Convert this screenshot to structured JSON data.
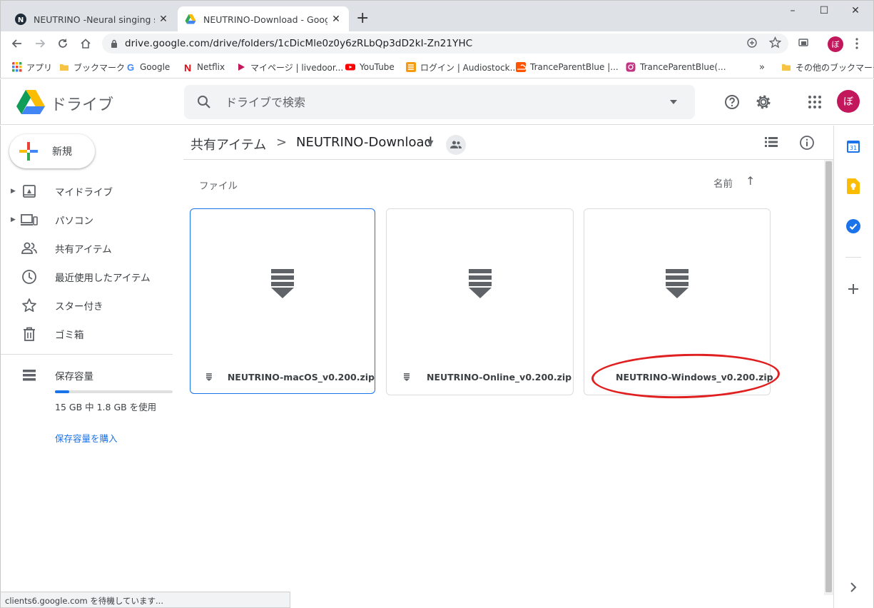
{
  "browser": {
    "tabs": [
      {
        "title": "NEUTRINO -Neural singing synthesizer",
        "active": false
      },
      {
        "title": "NEUTRINO-Download - Google Drive",
        "active": true
      }
    ],
    "new_tab": "+",
    "window_controls": {
      "minimize": "–",
      "maximize": "☐",
      "close": "✕"
    },
    "url": "drive.google.com/drive/folders/1cDicMle0z0y6zRLbQp3dD2kI-Zn21YHC",
    "profile_initial": "ぼ",
    "bookmarks": [
      {
        "label": "アプリ",
        "icon": "apps-grid-icon"
      },
      {
        "label": "ブックマーク",
        "icon": "folder-icon"
      },
      {
        "label": "Google",
        "icon": "google-icon"
      },
      {
        "label": "Netflix",
        "icon": "netflix-icon"
      },
      {
        "label": "マイページ | livedoor...",
        "icon": "livedoor-icon"
      },
      {
        "label": "YouTube",
        "icon": "youtube-icon"
      },
      {
        "label": "ログイン | Audiostock...",
        "icon": "audiostock-icon"
      },
      {
        "label": "TranceParentBlue |...",
        "icon": "soundcloud-icon"
      },
      {
        "label": "TranceParentBlue(...",
        "icon": "instagram-icon"
      }
    ],
    "bookmarks_overflow": "»",
    "other_bookmarks": "その他のブックマーク",
    "status_text": "clients6.google.com を待機しています..."
  },
  "drive": {
    "app_name": "ドライブ",
    "search_placeholder": "ドライブで検索",
    "new_button": "新規",
    "nav": [
      {
        "label": "マイドライブ",
        "icon": "my-drive-icon",
        "expandable": true
      },
      {
        "label": "パソコン",
        "icon": "computers-icon",
        "expandable": true
      },
      {
        "label": "共有アイテム",
        "icon": "shared-icon",
        "expandable": false
      },
      {
        "label": "最近使用したアイテム",
        "icon": "clock-icon",
        "expandable": false
      },
      {
        "label": "スター付き",
        "icon": "star-icon",
        "expandable": false
      },
      {
        "label": "ゴミ箱",
        "icon": "trash-icon",
        "expandable": false
      }
    ],
    "storage": {
      "label": "保存容量",
      "usage_text": "15 GB 中 1.8 GB を使用",
      "used_fraction": 0.12,
      "buy_link": "保存容量を購入"
    },
    "breadcrumb": {
      "root": "共有アイテム",
      "separator": ">",
      "current": "NEUTRINO-Download"
    },
    "section_label": "ファイル",
    "sort": {
      "label": "名前",
      "direction_symbol": "↑"
    },
    "files": [
      {
        "name": "NEUTRINO-macOS_v0.200.zip",
        "selected": true,
        "highlighted": false
      },
      {
        "name": "NEUTRINO-Online_v0.200.zip",
        "selected": false,
        "highlighted": false
      },
      {
        "name": "NEUTRINO-Windows_v0.200.zip",
        "selected": false,
        "highlighted": true
      }
    ],
    "side_panel": [
      "calendar-icon",
      "keep-icon",
      "tasks-icon",
      "add-icon"
    ],
    "side_panel_calendar_day": "31",
    "colors": {
      "accent_blue": "#1a73e8",
      "avatar": "#c2185b",
      "highlight_ring": "#e02020",
      "zip_icon": "#5f6368"
    }
  }
}
